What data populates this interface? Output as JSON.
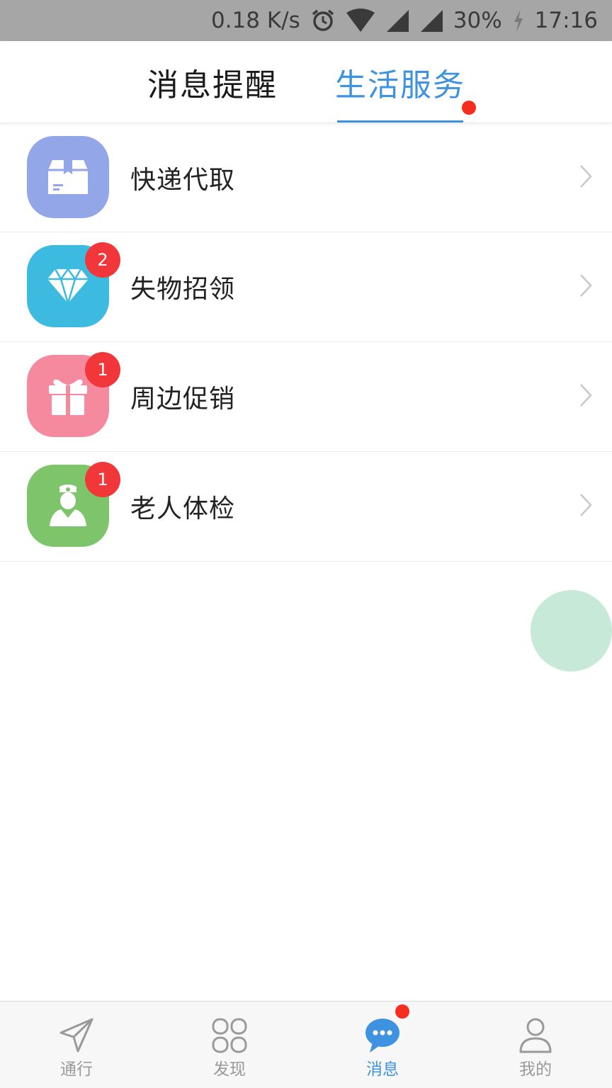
{
  "status_bar": {
    "net_speed": "0.18 K/s",
    "battery": "30%",
    "time": "17:16"
  },
  "top_tabs": {
    "messages": "消息提醒",
    "services": "生活服务",
    "active": "services"
  },
  "services": [
    {
      "label": "快递代取",
      "icon": "package-icon",
      "color": "#93a6e8",
      "badge": ""
    },
    {
      "label": "失物招领",
      "icon": "diamond-icon",
      "color": "#3dbadf",
      "badge": "2"
    },
    {
      "label": "周边促销",
      "icon": "gift-icon",
      "color": "#f58a9e",
      "badge": "1"
    },
    {
      "label": "老人体检",
      "icon": "nurse-icon",
      "color": "#7dc46a",
      "badge": "1"
    }
  ],
  "bottom_nav": [
    {
      "label": "通行",
      "icon": "send-icon"
    },
    {
      "label": "发现",
      "icon": "grid-icon"
    },
    {
      "label": "消息",
      "icon": "chat-icon"
    },
    {
      "label": "我的",
      "icon": "user-icon"
    }
  ],
  "colors": {
    "accent": "#3d93e0",
    "badge": "#f2373a",
    "dot": "#f52d1e",
    "fab": "#c6ead7"
  }
}
